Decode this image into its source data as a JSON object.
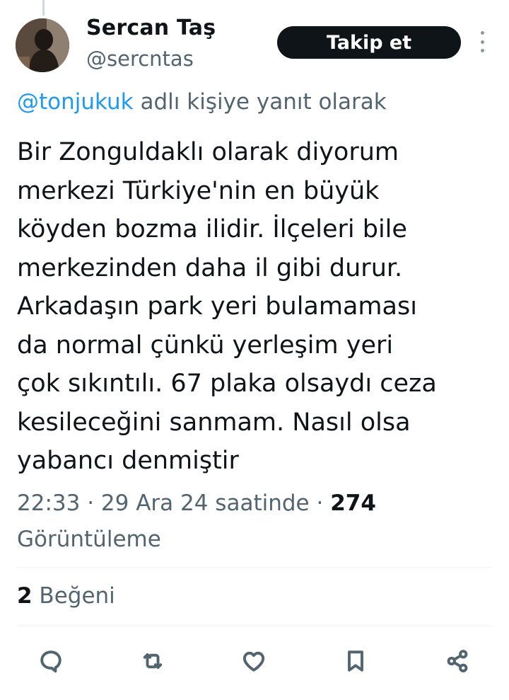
{
  "author": {
    "display_name": "Sercan Taş",
    "handle": "@sercntas",
    "follow_label": "Takip et"
  },
  "reply": {
    "mention": "@tonjukuk",
    "suffix": " adlı kişiye yanıt olarak"
  },
  "tweet": {
    "lines": [
      "Bir Zonguldaklı olarak diyorum",
      "merkezi Türkiye'nin en büyük",
      "köyden bozma ilidir. İlçeleri bile",
      "merkezinden daha il gibi durur.",
      "Arkadaşın park yeri bulamaması",
      "da normal çünkü yerleşim yeri",
      "çok sıkıntılı. 67 plaka olsaydı ceza",
      "kesileceğini sanmam. Nasıl olsa",
      "yabancı denmiştir"
    ]
  },
  "meta": {
    "time": "22:33",
    "sep1": " · ",
    "date": "29 Ara 24 saatinde",
    "sep2": " · ",
    "views_count": "274",
    "views_label": "Görüntüleme"
  },
  "engagement": {
    "likes_count": "2",
    "likes_label": " Beğeni"
  },
  "actions": {
    "icons": [
      "reply-icon",
      "retweet-icon",
      "like-icon",
      "bookmark-icon",
      "share-icon"
    ]
  },
  "colors": {
    "text": "#0f1419",
    "secondary": "#536471",
    "accent": "#1d9bf0",
    "button_bg": "#0f1419"
  }
}
